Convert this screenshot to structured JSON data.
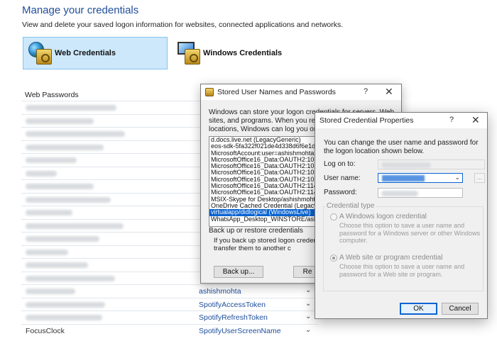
{
  "page": {
    "title": "Manage your credentials",
    "description": "View and delete your saved logon information for websites, connected applications and networks.",
    "tiles": {
      "web": "Web Credentials",
      "windows": "Windows Credentials"
    },
    "section_label": "Web Passwords",
    "visible_rows": [
      {
        "name": "ashishmohta"
      },
      {
        "name": "SpotifyAccessToken"
      },
      {
        "name": "SpotifyRefreshToken"
      },
      {
        "left": "FocusClock",
        "name": "SpotifyUserScreenName"
      }
    ]
  },
  "dialog_stored": {
    "title": "Stored User Names and Passwords",
    "help": "?",
    "close": "✕",
    "intro": "Windows can store your logon credentials for servers, Web sites, and programs. When you revisit one of those locations, Windows can log you on automatically.",
    "items": [
      "d.docs.live.net (LegacyGeneric)",
      "eos-sdk-5fa322f021de4d338d6f6e1dae8c",
      "MicrosoftAccount:user=ashishmohta@live.c",
      "MicrosoftOffice16_Data:OAUTH2:10566559",
      "MicrosoftOffice16_Data:OAUTH2:10566559",
      "MicrosoftOffice16_Data:OAUTH2:10590830",
      "MicrosoftOffice16_Data:OAUTH2:10590830",
      "MicrosoftOffice16_Data:OAUTH2:11463661",
      "MicrosoftOffice16_Data:OAUTH2:11463661",
      "MSIX-Skype for Desktop/ashishmohta (Leg",
      "OneDrive Cached Credential (LegacyGene",
      "virtualapp/didlogical (WindowsLive)",
      "WhatsApp_Desktop_WINSTORE/ashis (L"
    ],
    "selected_index": 11,
    "group_title": "Back up or restore credentials",
    "group_text": "If you back up stored logon credentials, yo restore them or transfer them to another c",
    "backup_label": "Back up...",
    "restore_label": "Re"
  },
  "dialog_props": {
    "title": "Stored Credential Properties",
    "help": "?",
    "close": "✕",
    "description": "You can change the user name and password for the logon location shown below.",
    "logon_label": "Log on to:",
    "username_label": "User name:",
    "password_label": "Password:",
    "browse_label": "...",
    "cred_type_title": "Credential type",
    "opt_windows_label": "A Windows logon credential",
    "opt_windows_desc": "Choose this option to save a user name and password for a Windows server or other Windows computer.",
    "opt_web_label": "A Web site or program credential",
    "opt_web_desc": "Choose this option to save a user name and password for a Web site or program.",
    "ok_label": "OK",
    "cancel_label": "Cancel"
  }
}
